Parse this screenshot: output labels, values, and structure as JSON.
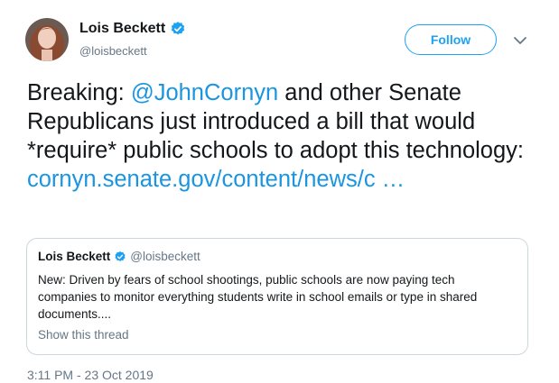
{
  "tweet": {
    "author_name": "Lois Beckett",
    "author_handle": "@loisbeckett",
    "follow_label": "Follow",
    "text_part1": "Breaking: ",
    "mention": "@JohnCornyn",
    "text_part2": " and other Senate Republicans just introduced a bill that would *require* public schools to adopt this technology: ",
    "link": "cornyn.senate.gov/content/news/c  …",
    "timestamp": "3:11 PM - 23 Oct 2019"
  },
  "quoted_tweet": {
    "author_name": "Lois Beckett",
    "author_handle": "@loisbeckett",
    "text": "New: Driven by fears of school shootings, public schools are now paying tech companies to monitor everything students write in school emails or type in shared documents....",
    "show_thread_label": "Show this thread"
  },
  "icons": {
    "verified": "verified-badge-icon",
    "menu": "chevron-down-icon",
    "avatar": "avatar-photo"
  },
  "colors": {
    "accent": "#1da1f2",
    "link": "#1b95e0",
    "text": "#14171a",
    "secondary": "#657786",
    "border": "#ccd6dd"
  }
}
